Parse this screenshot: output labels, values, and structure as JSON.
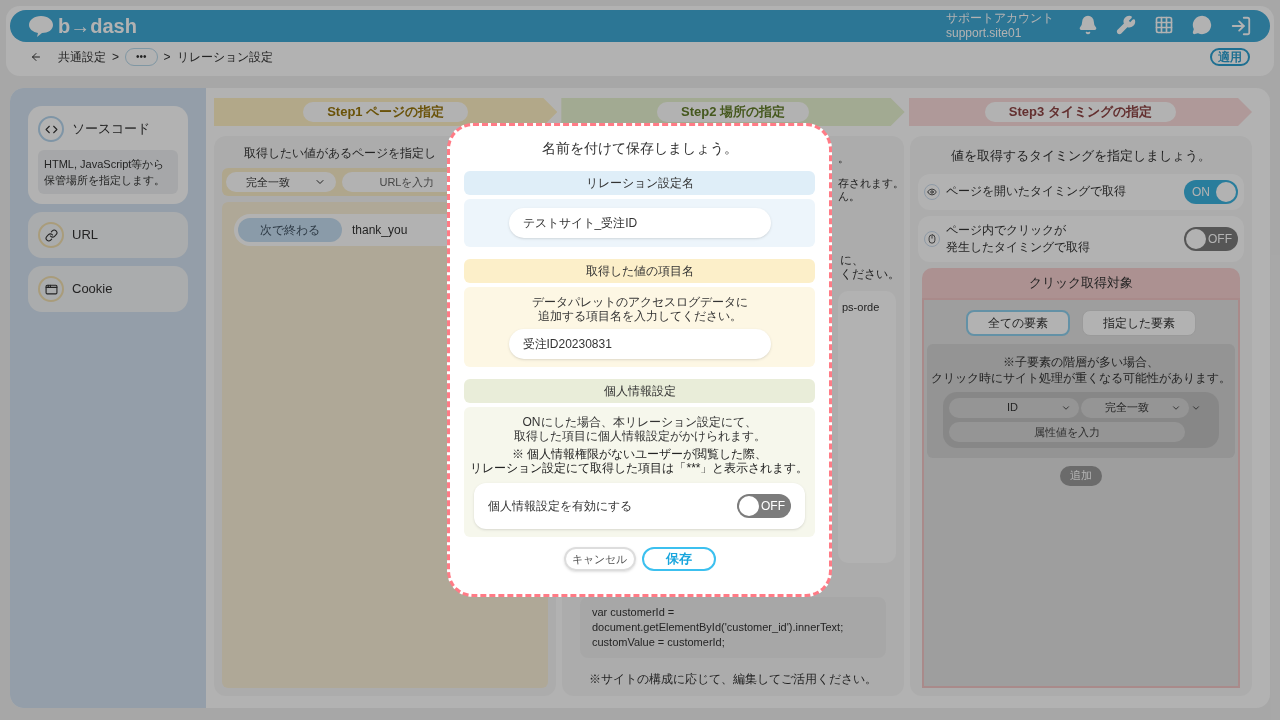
{
  "header": {
    "logo": "b→dash",
    "account_name": "サポートアカウント",
    "account_id": "support.site01"
  },
  "breadcrumb": [
    {
      "kind": "link",
      "label": "共通設定"
    },
    {
      "kind": "sep",
      "label": ">"
    },
    {
      "kind": "more",
      "label": "•••"
    },
    {
      "kind": "sep",
      "label": ">"
    },
    {
      "kind": "current",
      "label": "リレーション設定"
    }
  ],
  "apply_button": "適用",
  "sidebar": [
    {
      "kind": "code",
      "label": "ソースコード",
      "description_lines": [
        "HTML, JavaScript等から",
        "保管場所を指定します。"
      ],
      "selected": true
    },
    {
      "kind": "link",
      "label": "URL",
      "selected": false
    },
    {
      "kind": "window",
      "label": "Cookie",
      "selected": false
    }
  ],
  "steps": [
    {
      "label": "Step1 ページの指定",
      "color": "#b3a98a"
    },
    {
      "label": "Step2 場所の指定",
      "color": "#a3ab92"
    },
    {
      "label": "Step3 タイミングの指定",
      "color": "#b09a9a"
    }
  ],
  "step1": {
    "title": "取得したい値があるページを指定し",
    "match_select": "完全一致",
    "url_placeholder": "URLを入力",
    "rules": [
      {
        "match": "次で終わる",
        "value": "thank_you"
      }
    ]
  },
  "step2": {
    "fragments_top": [
      "。",
      "存されます。",
      "ん。"
    ],
    "fragments_mid": [
      "に、",
      "ください。"
    ],
    "card_text": "ps-orde",
    "code_lines": [
      "var customerId =",
      "document.getElementById('customer_id').innerText;",
      "customValue = customerId;"
    ],
    "note": "※サイトの構成に応じて、編集してご活用ください。"
  },
  "step3": {
    "title": "値を取得するタイミングを指定しましょう。",
    "triggers": [
      {
        "kind": "eye",
        "label_lines": [
          "ページを開いたタイミングで取得"
        ],
        "on": true,
        "switch_label": "ON"
      },
      {
        "kind": "mouse",
        "label_lines": [
          "ページ内でクリックが",
          "発生したタイミングで取得"
        ],
        "on": false,
        "switch_label": "OFF"
      }
    ],
    "click_target": {
      "title": "クリック取得対象",
      "tabs": [
        {
          "label": "全ての要素",
          "selected": true
        },
        {
          "label": "指定した要素",
          "selected": false
        }
      ],
      "note_lines": [
        "※子要素の階層が多い場合、",
        "クリック時にサイト処理が重くなる可能性があります。"
      ],
      "attribute_select": "ID",
      "match_select": "完全一致",
      "value_placeholder": "属性値を入力",
      "add_button": "追加"
    }
  },
  "modal": {
    "title": "名前を付けて保存しましょう。",
    "name_section": {
      "header": "リレーション設定名",
      "value": "テストサイト_受注ID"
    },
    "item_section": {
      "header": "取得した値の項目名",
      "description_lines": [
        "データパレットのアクセスログデータに",
        "追加する項目名を入力してください。"
      ],
      "value": "受注ID20230831"
    },
    "privacy_section": {
      "header": "個人情報設定",
      "description_lines": [
        "ONにした場合、本リレーション設定にて、",
        "取得した項目に個人情報設定がかけられます。"
      ],
      "note_lines": [
        "※ 個人情報権限がないユーザーが閲覧した際、",
        "リレーション設定にて取得した項目は「***」と表示されます。"
      ],
      "toggle_label": "個人情報設定を有効にする",
      "on": false,
      "switch_label": "OFF"
    },
    "cancel_button": "キャンセル",
    "save_button": "保存"
  }
}
